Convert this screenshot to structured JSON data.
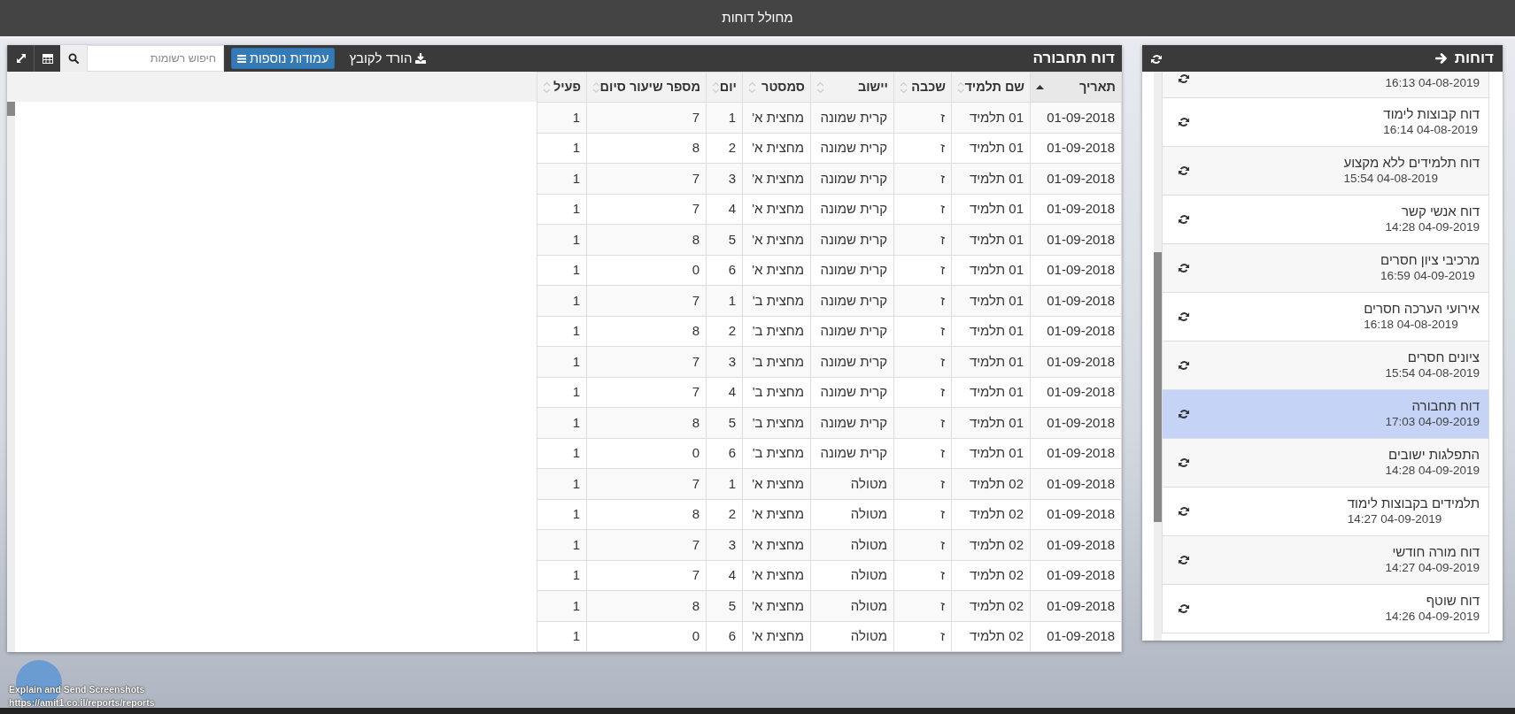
{
  "app_title": "מחולל דוחות",
  "sidebar": {
    "title": "דוחות",
    "items": [
      {
        "time": "16:13 04-08-2019",
        "selected": false
      },
      {
        "name": "דוח קבוצות לימוד",
        "time": "16:14 04-08-2019",
        "selected": false
      },
      {
        "name": "דוח תלמידים ללא מקצוע",
        "time": "15:54 04-08-2019",
        "selected": false
      },
      {
        "name": "דוח אנשי קשר",
        "time": "14:28 04-09-2019",
        "selected": false
      },
      {
        "name": "מרכיבי ציון חסרים",
        "time": "16:59 04-09-2019",
        "selected": false
      },
      {
        "name": "אירועי הערכה חסרים",
        "time": "16:18 04-08-2019",
        "selected": false
      },
      {
        "name": "ציונים חסרים",
        "time": "15:54 04-08-2019",
        "selected": false
      },
      {
        "name": "דוח תחבורה",
        "time": "17:03 04-09-2019",
        "selected": true
      },
      {
        "name": "התפלגות ישובים",
        "time": "14:28 04-09-2019",
        "selected": false
      },
      {
        "name": "תלמידים בקבוצות לימוד",
        "time": "14:27 04-09-2019",
        "selected": false
      },
      {
        "name": "דוח מורה חודשי",
        "time": "14:27 04-09-2019",
        "selected": false
      },
      {
        "name": "דוח שוטף",
        "time": "14:26 04-09-2019",
        "selected": false
      }
    ]
  },
  "report": {
    "title": "דוח תחבורה",
    "download_label": "הורד לקובץ",
    "columns_button": "עמודות נוספות",
    "search": {
      "placeholder": "חיפוש רשומות"
    },
    "table": {
      "columns": [
        {
          "label": "תאריך",
          "sorted": true
        },
        {
          "label": "שם תלמיד",
          "sorted": false
        },
        {
          "label": "שכבה",
          "sorted": false
        },
        {
          "label": "יישוב",
          "sorted": false
        },
        {
          "label": "סמסטר",
          "sorted": false
        },
        {
          "label": "יום",
          "sorted": false
        },
        {
          "label": "מספר שיעור סיום",
          "sorted": false
        },
        {
          "label": "פעיל",
          "sorted": false
        }
      ],
      "rows": [
        [
          "01-09-2018",
          "01 תלמיד",
          "ז",
          "קרית שמונה",
          "מחצית א'",
          "1",
          "7",
          "1"
        ],
        [
          "01-09-2018",
          "01 תלמיד",
          "ז",
          "קרית שמונה",
          "מחצית א'",
          "2",
          "8",
          "1"
        ],
        [
          "01-09-2018",
          "01 תלמיד",
          "ז",
          "קרית שמונה",
          "מחצית א'",
          "3",
          "7",
          "1"
        ],
        [
          "01-09-2018",
          "01 תלמיד",
          "ז",
          "קרית שמונה",
          "מחצית א'",
          "4",
          "7",
          "1"
        ],
        [
          "01-09-2018",
          "01 תלמיד",
          "ז",
          "קרית שמונה",
          "מחצית א'",
          "5",
          "8",
          "1"
        ],
        [
          "01-09-2018",
          "01 תלמיד",
          "ז",
          "קרית שמונה",
          "מחצית א'",
          "6",
          "0",
          "1"
        ],
        [
          "01-09-2018",
          "01 תלמיד",
          "ז",
          "קרית שמונה",
          "מחצית ב'",
          "1",
          "7",
          "1"
        ],
        [
          "01-09-2018",
          "01 תלמיד",
          "ז",
          "קרית שמונה",
          "מחצית ב'",
          "2",
          "8",
          "1"
        ],
        [
          "01-09-2018",
          "01 תלמיד",
          "ז",
          "קרית שמונה",
          "מחצית ב'",
          "3",
          "7",
          "1"
        ],
        [
          "01-09-2018",
          "01 תלמיד",
          "ז",
          "קרית שמונה",
          "מחצית ב'",
          "4",
          "7",
          "1"
        ],
        [
          "01-09-2018",
          "01 תלמיד",
          "ז",
          "קרית שמונה",
          "מחצית ב'",
          "5",
          "8",
          "1"
        ],
        [
          "01-09-2018",
          "01 תלמיד",
          "ז",
          "קרית שמונה",
          "מחצית ב'",
          "6",
          "0",
          "1"
        ],
        [
          "01-09-2018",
          "02 תלמיד",
          "ז",
          "מטולה",
          "מחצית א'",
          "1",
          "7",
          "1"
        ],
        [
          "01-09-2018",
          "02 תלמיד",
          "ז",
          "מטולה",
          "מחצית א'",
          "2",
          "8",
          "1"
        ],
        [
          "01-09-2018",
          "02 תלמיד",
          "ז",
          "מטולה",
          "מחצית א'",
          "3",
          "7",
          "1"
        ],
        [
          "01-09-2018",
          "02 תלמיד",
          "ז",
          "מטולה",
          "מחצית א'",
          "4",
          "7",
          "1"
        ],
        [
          "01-09-2018",
          "02 תלמיד",
          "ז",
          "מטולה",
          "מחצית א'",
          "5",
          "8",
          "1"
        ],
        [
          "01-09-2018",
          "02 תלמיד",
          "ז",
          "מטולה",
          "מחצית א'",
          "6",
          "0",
          "1"
        ]
      ]
    }
  },
  "capture_overlay": {
    "title": "Explain and Send Screenshots",
    "url": "https://amit1.co.il/reports/reports"
  }
}
